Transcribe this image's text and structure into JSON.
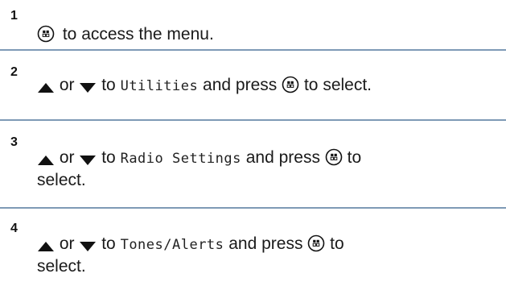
{
  "steps": [
    {
      "number": "1",
      "parts": {
        "text": "to access the menu."
      }
    },
    {
      "number": "2",
      "parts": {
        "or": "or",
        "to": "to",
        "target": "Utilities",
        "and_press": "and press",
        "to_select": "to select."
      }
    },
    {
      "number": "3",
      "parts": {
        "or": "or",
        "to": "to",
        "target": "Radio Settings",
        "and_press": "and press",
        "select": "select."
      }
    },
    {
      "number": "4",
      "parts": {
        "or": "or",
        "to": "to",
        "target": "Tones/Alerts",
        "and_press": "and press",
        "to2": "to",
        "select": "select."
      }
    }
  ],
  "icons": {
    "menu_button": "menu-ok-button-icon",
    "up": "up-arrow-icon",
    "down": "down-arrow-icon"
  },
  "colors": {
    "divider": "#7e9ab6",
    "text": "#1a1a1a"
  }
}
